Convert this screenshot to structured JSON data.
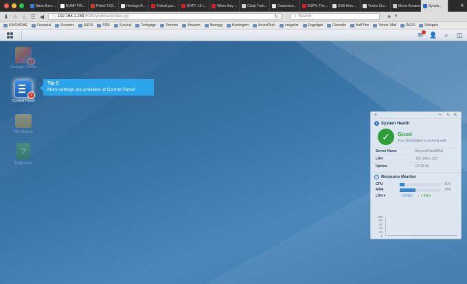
{
  "browser": {
    "tabs": [
      {
        "label": "Nano 8mm ...",
        "color": "#3e7bd6"
      },
      {
        "label": "BUMP F/R...",
        "color": "#ffffff"
      },
      {
        "label": "Polish 7.62...",
        "color": "#d33a2c"
      },
      {
        "label": "Heritage R...",
        "color": "#e6e6e6"
      },
      {
        "label": "5 ideal gun...",
        "color": "#d6202b"
      },
      {
        "label": "SHTF: 10 r...",
        "color": "#d6202b"
      },
      {
        "label": "When they ...",
        "color": "#d6202b"
      },
      {
        "label": "Cloak Tuck...",
        "color": "#d0d0d0"
      },
      {
        "label": "Customize...",
        "color": "#e8e8e8"
      },
      {
        "label": "ESPN: The ...",
        "color": "#d6202b"
      },
      {
        "label": "KNS Hitm...",
        "color": "#e0e0e0"
      },
      {
        "label": "Vortex Cro...",
        "color": "#e0e0e0"
      },
      {
        "label": "Movie Armame...",
        "color": "#c8c8c8"
      },
      {
        "label": "Synolo...",
        "color": "#2a6ac0"
      }
    ],
    "url": {
      "host": "192.168.1.233",
      "path": ":5000/webman/index.cgi"
    },
    "search_placeholder": "Search",
    "bookmarks": [
      "KINGHOME",
      "Financial",
      "Firearms",
      "IUPUI",
      "PEN",
      "Survival",
      "Techgage",
      "Torrents",
      "Amazon",
      "Newegg",
      "Huntington",
      "AnandTech",
      "craigslist",
      "Engadget",
      "Gizmodo",
      "Huff Pon",
      "Yahoo! Mail",
      "INGO",
      "Slickgate"
    ]
  },
  "desktop": {
    "icons": [
      {
        "label": "Package Center",
        "badge": "5"
      },
      {
        "label": "Control Panel",
        "badge": "1"
      },
      {
        "label": "File Station",
        "badge": ""
      },
      {
        "label": "DSM Help",
        "badge": ""
      }
    ],
    "tip": {
      "title": "Tip 3",
      "text": "More settings are available at Control Panel!"
    }
  },
  "widget": {
    "health": {
      "title": "System Health",
      "status": "Good",
      "status_text": "Your DiskStation is working well.",
      "rows": [
        {
          "key": "Server Name",
          "value": "BeyondCloudNAS"
        },
        {
          "key": "LAN",
          "value": "192.168.1.233"
        },
        {
          "key": "Uptime",
          "value": "00:22:36"
        }
      ]
    },
    "resource": {
      "title": "Resource Monitor",
      "cpu_label": "CPU",
      "cpu_value": "11%",
      "cpu_fraction": 0.11,
      "ram_label": "RAM",
      "ram_value": "38%",
      "ram_fraction": 0.38,
      "lan_label": "LAN",
      "lan_up": "2 KB/s",
      "lan_down": "1 KB/s",
      "graph_ticks": [
        "100",
        "80",
        "60",
        "40",
        "20",
        "0"
      ]
    }
  },
  "colors": {
    "accent": "#2aa4ea",
    "good": "#2e9e36",
    "bar": "#2e86d4"
  }
}
